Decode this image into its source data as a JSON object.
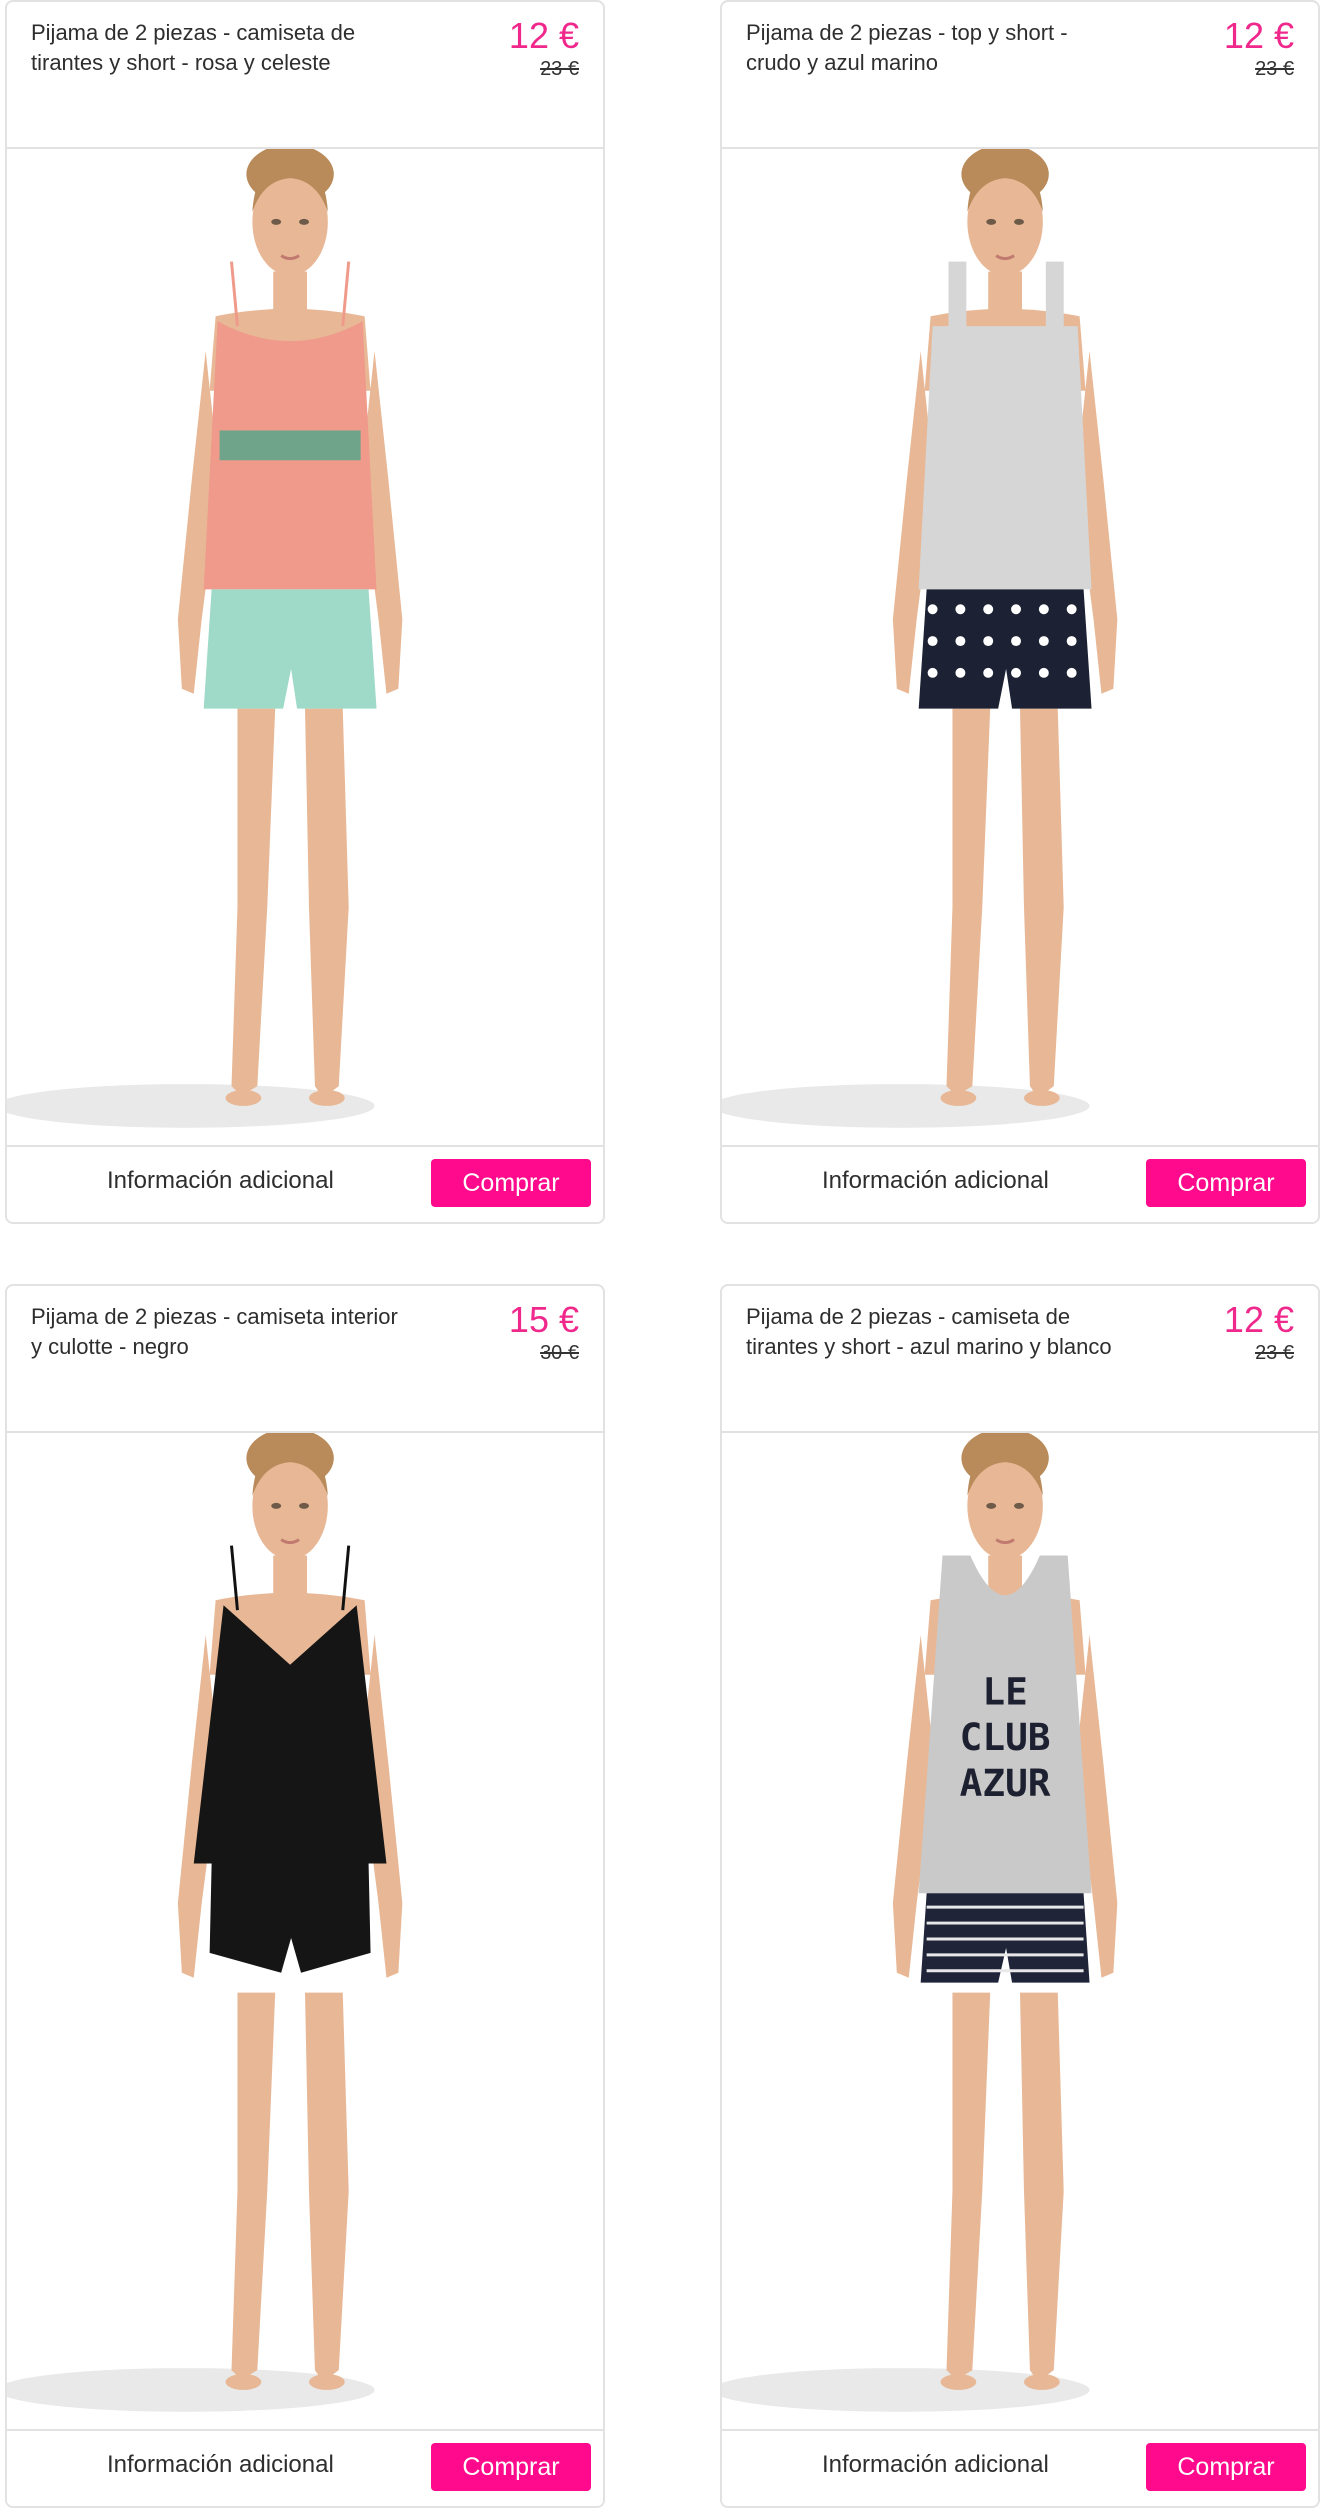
{
  "products": [
    {
      "title": "Pijama de 2 piezas - camiseta de tirantes y short - rosa y celeste",
      "price": "12 €",
      "old_price": "23 €",
      "info_label": "Información adicional",
      "buy_label": "Comprar",
      "top_color": "#ef9a8b",
      "bottom_color": "#9fd9c8",
      "pattern_color": "#3aa88a"
    },
    {
      "title": "Pijama de 2 piezas - top y short - crudo y azul marino",
      "price": "12 €",
      "old_price": "23 €",
      "info_label": "Información adicional",
      "buy_label": "Comprar",
      "top_color": "#d6d6d6",
      "bottom_color": "#1c2233",
      "pattern_color": "#ffffff"
    },
    {
      "title": "Pijama de 2 piezas - camiseta interior y culotte - negro",
      "price": "15 €",
      "old_price": "30 €",
      "info_label": "Información adicional",
      "buy_label": "Comprar",
      "top_color": "#151515",
      "bottom_color": "#151515",
      "pattern_color": "#151515"
    },
    {
      "title": "Pijama de 2 piezas - camiseta de tirantes y short - azul marino y blanco",
      "price": "12 €",
      "old_price": "23 €",
      "info_label": "Información adicional",
      "buy_label": "Comprar",
      "top_color": "#c9c9c9",
      "bottom_color": "#1f2438",
      "pattern_color": "#e8e8e8",
      "print_text": "LE CLUB AZUR"
    }
  ],
  "colors": {
    "accent": "#ff0a8c",
    "price": "#f0288c",
    "border": "#e2e2e2",
    "skin": "#e8b896",
    "hair": "#b98a5a"
  }
}
